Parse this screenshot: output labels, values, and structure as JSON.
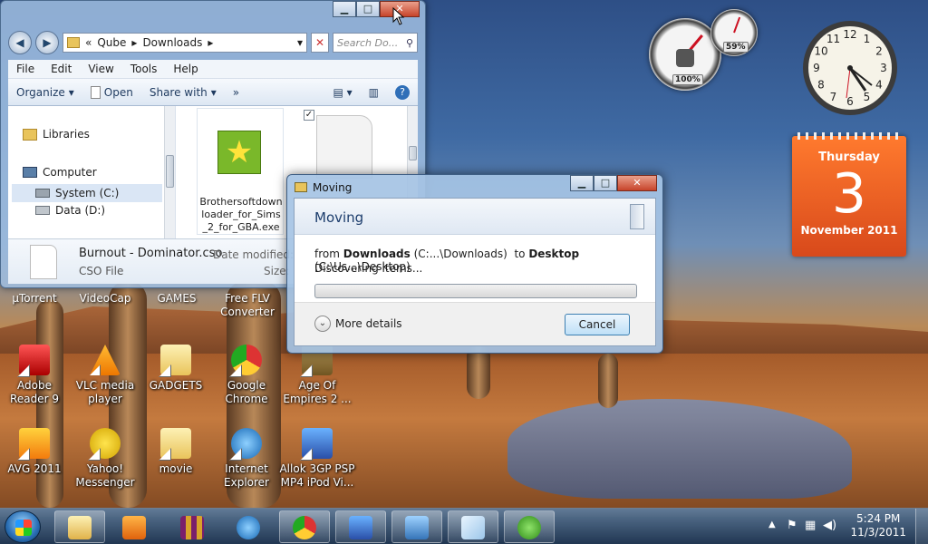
{
  "explorer": {
    "nav_back": "◀",
    "nav_forward": "▶",
    "address": {
      "prefix": "«",
      "segments": [
        "Qube",
        "Downloads"
      ]
    },
    "search_placeholder": "Search Do...",
    "menu": [
      "File",
      "Edit",
      "View",
      "Tools",
      "Help"
    ],
    "toolbar": {
      "organize": "Organize",
      "open": "Open",
      "share_with": "Share with",
      "more": "»"
    },
    "nav_pane": [
      "Libraries",
      "Computer",
      "System (C:)",
      "Data (D:)"
    ],
    "files": [
      {
        "name": "Brothersoftdownloader_for_Sims_2_for_GBA.exe"
      }
    ],
    "details": {
      "filename": "Burnout - Dominator.cso",
      "filetype": "CSO File",
      "date_modified_label": "Date modified:",
      "size_label": "Size:"
    }
  },
  "dialog": {
    "title": "Moving",
    "header": "Moving",
    "from_label": "from",
    "from_folder": "Downloads",
    "from_path": "(C:...\\Downloads)",
    "to_label": "to",
    "to_folder": "Desktop",
    "to_path": "(C:\\Us...\\Desktop)",
    "status": "Discovering items...",
    "progress": 0,
    "more_details": "More details",
    "cancel": "Cancel"
  },
  "desktop_icons": {
    "row1": [
      "µTorrent",
      "VideoCap",
      "GAMES",
      "Free FLV Converter"
    ],
    "row2": [
      "Adobe Reader 9",
      "VLC media player",
      "GADGETS",
      "Google Chrome",
      "Age Of Empires 2 ..."
    ],
    "row3": [
      "AVG 2011",
      "Yahoo! Messenger",
      "movie",
      "Internet Explorer",
      "Allok 3GP PSP MP4 iPod Vi..."
    ]
  },
  "gadgets": {
    "cpu_percent": "100%",
    "memory_percent": "59%",
    "clock_numbers": [
      "12",
      "1",
      "2",
      "3",
      "4",
      "5",
      "6",
      "7",
      "8",
      "9",
      "10",
      "11"
    ],
    "calendar": {
      "weekday": "Thursday",
      "day": "3",
      "month_year": "November 2011"
    }
  },
  "taskbar": {
    "time": "5:24 PM",
    "date": "11/3/2011"
  },
  "colors": {
    "accent": "#2f7ab8",
    "calendar": "#e8611f",
    "close_button": "#c7442a"
  }
}
